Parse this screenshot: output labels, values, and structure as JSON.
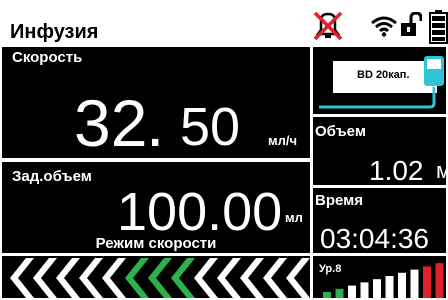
{
  "header": {
    "title": "Инфузия",
    "icons": [
      "alarm-muted-icon",
      "wifi-icon",
      "unlock-icon",
      "battery-icon"
    ]
  },
  "speed": {
    "label": "Скорость",
    "value_int": "32",
    "value_dot": ".",
    "value_frac": "50",
    "unit": "мл/ч"
  },
  "vtbi": {
    "label": "Зад.объем",
    "value": "100.00",
    "unit": "мл",
    "mode": "Режим скорости"
  },
  "syringe": {
    "label": "BD 20кап."
  },
  "volume": {
    "label": "Объем",
    "value": "1.02",
    "unit": "мл"
  },
  "time": {
    "label": "Время",
    "value": "03:04:36"
  },
  "level": {
    "label": "Ур.8",
    "level": 8
  },
  "colors": {
    "accent_green": "#2bb24c",
    "alarm_red": "#e0202a",
    "cyan": "#2fc3d8",
    "level_red": "#e0202a"
  }
}
